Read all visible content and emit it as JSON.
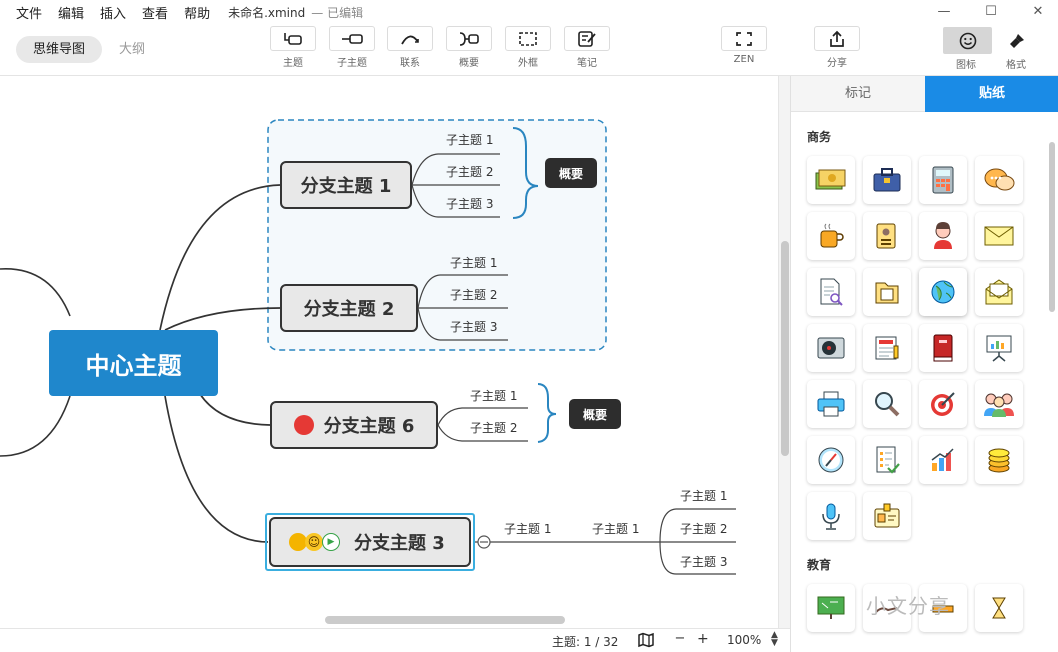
{
  "menu": {
    "items": [
      "文件",
      "编辑",
      "插入",
      "查看",
      "帮助"
    ],
    "title": "未命名.xmind",
    "subtitle": "— 已编辑"
  },
  "window": {
    "minimize": "—",
    "maximize": "☐",
    "close": "✕"
  },
  "views": {
    "mindmap": "思维导图",
    "outline": "大纲"
  },
  "tools": {
    "topic": "主题",
    "subtopic": "子主题",
    "relation": "联系",
    "summary": "概要",
    "boundary": "外框",
    "note": "笔记",
    "zen": "ZEN",
    "share": "分享",
    "icon": "图标",
    "format": "格式"
  },
  "map": {
    "central": "中心主题",
    "b1": "分支主题 1",
    "b2": "分支主题 2",
    "b6": "分支主题 6",
    "b3": "分支主题 3",
    "b1_subs": [
      "子主题 1",
      "子主题 2",
      "子主题 3"
    ],
    "b2_subs": [
      "子主题 1",
      "子主题 2",
      "子主题 3"
    ],
    "b6_subs": [
      "子主题 1",
      "子主题 2"
    ],
    "b3_sub": "子主题 1",
    "b3_sub2": "子主题 1",
    "b3_subsubs": [
      "子主题 1",
      "子主题 2",
      "子主题 3"
    ],
    "summary1": "概要",
    "summary2": "概要"
  },
  "status": {
    "topic_count": "主题: 1 / 32",
    "zoom": "100%",
    "zoom_out": "−",
    "zoom_in": "+"
  },
  "panel": {
    "tab_marks": "标记",
    "tab_stickers": "贴纸",
    "section_business": "商务",
    "section_education": "教育"
  },
  "colors": {
    "accent": "#1a8be6",
    "central": "#1f87cc",
    "summary_bg": "#2d2d2d",
    "red_marker": "#e53935"
  },
  "watermark": "小文分享"
}
